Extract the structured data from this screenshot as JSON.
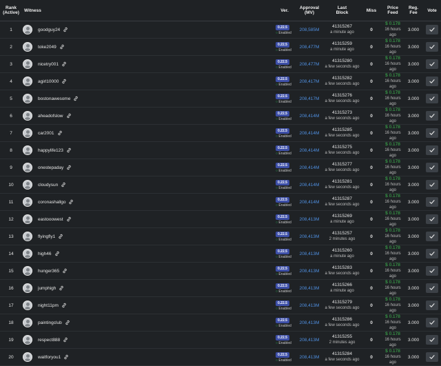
{
  "headers": {
    "rank": "Rank",
    "rank_sub": "(Active)",
    "witness": "Witness",
    "ver": "Ver.",
    "approval": "Approval",
    "approval_sub": "(MV)",
    "last_block": "Last",
    "last_block_sub": "Block",
    "miss": "Miss",
    "price_feed": "Price",
    "price_feed_sub": "Feed",
    "reg_fee": "Reg.",
    "reg_fee_sub": "Fee",
    "vote": "Vote"
  },
  "enabled_label": "Enabled",
  "rows": [
    {
      "rank": "1",
      "name": "goodguy24",
      "version": "0.22.5",
      "approval": "208,585M",
      "block": "41315267",
      "block_time": "a minute ago",
      "miss": "0",
      "price": "$ 0.178",
      "price_time": "16 hours ago",
      "fee": "3.000"
    },
    {
      "rank": "2",
      "name": "toke2049",
      "version": "0.22.5",
      "approval": "208,477M",
      "block": "41315259",
      "block_time": "a minute ago",
      "miss": "0",
      "price": "$ 0.178",
      "price_time": "16 hours ago",
      "fee": "3.000"
    },
    {
      "rank": "3",
      "name": "nicetry001",
      "version": "0.22.5",
      "approval": "208,477M",
      "block": "41315280",
      "block_time": "a few seconds ago",
      "miss": "0",
      "price": "$ 0.178",
      "price_time": "16 hours ago",
      "fee": "3.000"
    },
    {
      "rank": "4",
      "name": "agirl10000",
      "version": "0.22.5",
      "approval": "208,417M",
      "block": "41315282",
      "block_time": "a few seconds ago",
      "miss": "0",
      "price": "$ 0.178",
      "price_time": "16 hours ago",
      "fee": "3.000"
    },
    {
      "rank": "5",
      "name": "bostonawesome",
      "version": "0.22.5",
      "approval": "208,417M",
      "block": "41315276",
      "block_time": "a few seconds ago",
      "miss": "0",
      "price": "$ 0.178",
      "price_time": "16 hours ago",
      "fee": "3.000"
    },
    {
      "rank": "6",
      "name": "aheadofslow",
      "version": "0.22.5",
      "approval": "208,414M",
      "block": "41315273",
      "block_time": "a few seconds ago",
      "miss": "0",
      "price": "$ 0.178",
      "price_time": "16 hours ago",
      "fee": "3.000"
    },
    {
      "rank": "7",
      "name": "car2001",
      "version": "0.22.5",
      "approval": "208,414M",
      "block": "41315285",
      "block_time": "a few seconds ago",
      "miss": "0",
      "price": "$ 0.178",
      "price_time": "16 hours ago",
      "fee": "3.000"
    },
    {
      "rank": "8",
      "name": "happylife123",
      "version": "0.22.5",
      "approval": "208,414M",
      "block": "41315275",
      "block_time": "a few seconds ago",
      "miss": "0",
      "price": "$ 0.178",
      "price_time": "16 hours ago",
      "fee": "3.000"
    },
    {
      "rank": "9",
      "name": "onestepaday",
      "version": "0.22.5",
      "approval": "208,414M",
      "block": "41315277",
      "block_time": "a few seconds ago",
      "miss": "0",
      "price": "$ 0.178",
      "price_time": "16 hours ago",
      "fee": "3.000"
    },
    {
      "rank": "10",
      "name": "cloudysun",
      "version": "0.22.5",
      "approval": "208,414M",
      "block": "41315281",
      "block_time": "a few seconds ago",
      "miss": "0",
      "price": "$ 0.178",
      "price_time": "16 hours ago",
      "fee": "3.000"
    },
    {
      "rank": "11",
      "name": "coronashallgo",
      "version": "0.22.5",
      "approval": "208,414M",
      "block": "41315287",
      "block_time": "a few seconds ago",
      "miss": "0",
      "price": "$ 0.178",
      "price_time": "16 hours ago",
      "fee": "3.000"
    },
    {
      "rank": "12",
      "name": "eastooowest",
      "version": "0.22.5",
      "approval": "208,413M",
      "block": "41315269",
      "block_time": "a minute ago",
      "miss": "0",
      "price": "$ 0.178",
      "price_time": "16 hours ago",
      "fee": "3.000"
    },
    {
      "rank": "13",
      "name": "flyingfly1",
      "version": "0.22.5",
      "approval": "208,413M",
      "block": "41315257",
      "block_time": "2 minutes ago",
      "miss": "0",
      "price": "$ 0.178",
      "price_time": "16 hours ago",
      "fee": "3.000"
    },
    {
      "rank": "14",
      "name": "high46",
      "version": "0.22.5",
      "approval": "208,413M",
      "block": "41315260",
      "block_time": "a minute ago",
      "miss": "0",
      "price": "$ 0.178",
      "price_time": "16 hours ago",
      "fee": "3.000"
    },
    {
      "rank": "15",
      "name": "hunger365",
      "version": "0.22.5",
      "approval": "208,413M",
      "block": "41315283",
      "block_time": "a few seconds ago",
      "miss": "0",
      "price": "$ 0.178",
      "price_time": "16 hours ago",
      "fee": "3.000"
    },
    {
      "rank": "16",
      "name": "jumphigh",
      "version": "0.22.5",
      "approval": "208,413M",
      "block": "41315266",
      "block_time": "a minute ago",
      "miss": "0",
      "price": "$ 0.178",
      "price_time": "16 hours ago",
      "fee": "3.000"
    },
    {
      "rank": "17",
      "name": "night11pm",
      "version": "0.22.5",
      "approval": "208,413M",
      "block": "41315279",
      "block_time": "a few seconds ago",
      "miss": "0",
      "price": "$ 0.178",
      "price_time": "16 hours ago",
      "fee": "3.000"
    },
    {
      "rank": "18",
      "name": "paintingclub",
      "version": "0.22.5",
      "approval": "208,413M",
      "block": "41315286",
      "block_time": "a few seconds ago",
      "miss": "0",
      "price": "$ 0.178",
      "price_time": "16 hours ago",
      "fee": "3.000"
    },
    {
      "rank": "19",
      "name": "respect888",
      "version": "0.22.5",
      "approval": "208,413M",
      "block": "41315255",
      "block_time": "2 minutes ago",
      "miss": "0",
      "price": "$ 0.178",
      "price_time": "16 hours ago",
      "fee": "3.000"
    },
    {
      "rank": "20",
      "name": "waitforyou1",
      "version": "0.22.5",
      "approval": "208,413M",
      "block": "41315284",
      "block_time": "a few seconds ago",
      "miss": "0",
      "price": "$ 0.178",
      "price_time": "16 hours ago",
      "fee": "3.000"
    }
  ]
}
